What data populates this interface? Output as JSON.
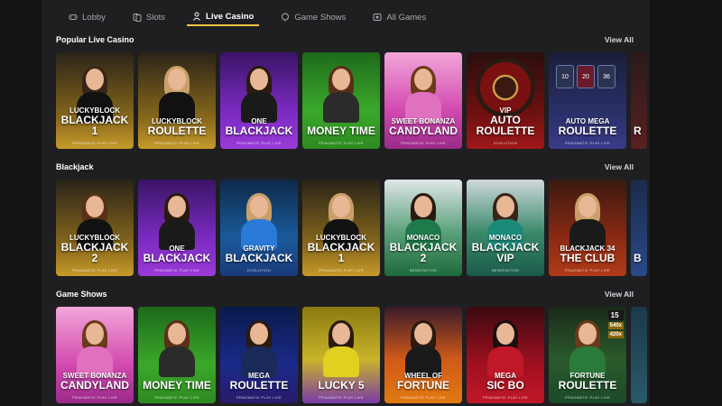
{
  "nav": {
    "items": [
      {
        "label": "Lobby",
        "icon": "gamepad-icon",
        "active": false
      },
      {
        "label": "Slots",
        "icon": "cards-icon",
        "active": false
      },
      {
        "label": "Live Casino",
        "icon": "dealer-icon",
        "active": true
      },
      {
        "label": "Game Shows",
        "icon": "gameshow-icon",
        "active": false
      },
      {
        "label": "All Games",
        "icon": "all-games-icon",
        "active": false
      }
    ]
  },
  "colors": {
    "accent": "#f6c542",
    "background": "#1f1f21",
    "sidebar": "#131314"
  },
  "sections": [
    {
      "title": "Popular Live Casino",
      "view_all": "View All",
      "cards": [
        {
          "line1": "LUCKYBLOCK",
          "line2": "BLACKJACK 1",
          "provider": "PRAGMATIC PLAY LIVE"
        },
        {
          "line1": "LUCKYBLOCK",
          "line2": "ROULETTE",
          "provider": "PRAGMATIC PLAY LIVE"
        },
        {
          "line1": "ONE",
          "line2": "BLACKJACK",
          "provider": "PRAGMATIC PLAY LIVE"
        },
        {
          "line1": "",
          "line2": "MONEY TIME",
          "provider": "PRAGMATIC PLAY LIVE"
        },
        {
          "line1": "SWEET BONANZA",
          "line2": "CANDYLAND",
          "provider": "PRAGMATIC PLAY LIVE"
        },
        {
          "line1": "VIP",
          "line2": "AUTO ROULETTE",
          "provider": "EVOLUTION"
        },
        {
          "line1": "AUTO MEGA",
          "line2": "ROULETTE",
          "provider": "PRAGMATIC PLAY LIVE"
        },
        {
          "line1": "",
          "line2": "R",
          "provider": ""
        }
      ]
    },
    {
      "title": "Blackjack",
      "view_all": "View All",
      "cards": [
        {
          "line1": "LUCKYBLOCK",
          "line2": "BLACKJACK 2",
          "provider": "PRAGMATIC PLAY LIVE"
        },
        {
          "line1": "ONE",
          "line2": "BLACKJACK",
          "provider": "PRAGMATIC PLAY LIVE"
        },
        {
          "line1": "GRAVITY",
          "line2": "BLACKJACK",
          "provider": "EVOLUTION"
        },
        {
          "line1": "LUCKYBLOCK",
          "line2": "BLACKJACK 1",
          "provider": "PRAGMATIC PLAY LIVE"
        },
        {
          "line1": "MONACO",
          "line2": "BLACKJACK 2",
          "provider": "BENEFACTOR"
        },
        {
          "line1": "MONACO",
          "line2": "BLACKJACK VIP",
          "provider": "BENEFACTOR"
        },
        {
          "line1": "BLACKJACK 34",
          "line2": "THE CLUB",
          "provider": "PRAGMATIC PLAY LIVE"
        },
        {
          "line1": "",
          "line2": "B",
          "provider": ""
        }
      ]
    },
    {
      "title": "Game Shows",
      "view_all": "View All",
      "cards": [
        {
          "line1": "SWEET BONANZA",
          "line2": "CANDYLAND",
          "provider": "PRAGMATIC PLAY LIVE"
        },
        {
          "line1": "",
          "line2": "MONEY TIME",
          "provider": "PRAGMATIC PLAY LIVE"
        },
        {
          "line1": "MEGA",
          "line2": "ROULETTE",
          "provider": "PRAGMATIC PLAY LIVE"
        },
        {
          "line1": "",
          "line2": "LUCKY 5",
          "provider": "PRAGMATIC PLAY LIVE"
        },
        {
          "line1": "WHEEL OF",
          "line2": "FORTUNE",
          "provider": "PRAGMATIC PLAY LIVE"
        },
        {
          "line1": "MEGA",
          "line2": "SIC BO",
          "provider": "PRAGMATIC PLAY LIVE"
        },
        {
          "line1": "FORTUNE",
          "line2": "ROULETTE",
          "provider": "PRAGMATIC PLAY LIVE"
        },
        {
          "line1": "",
          "line2": "",
          "provider": ""
        }
      ]
    }
  ],
  "roulette_numbers": [
    "10",
    "20",
    "36"
  ],
  "table_multipliers": [
    "15",
    "540x",
    "420x"
  ]
}
